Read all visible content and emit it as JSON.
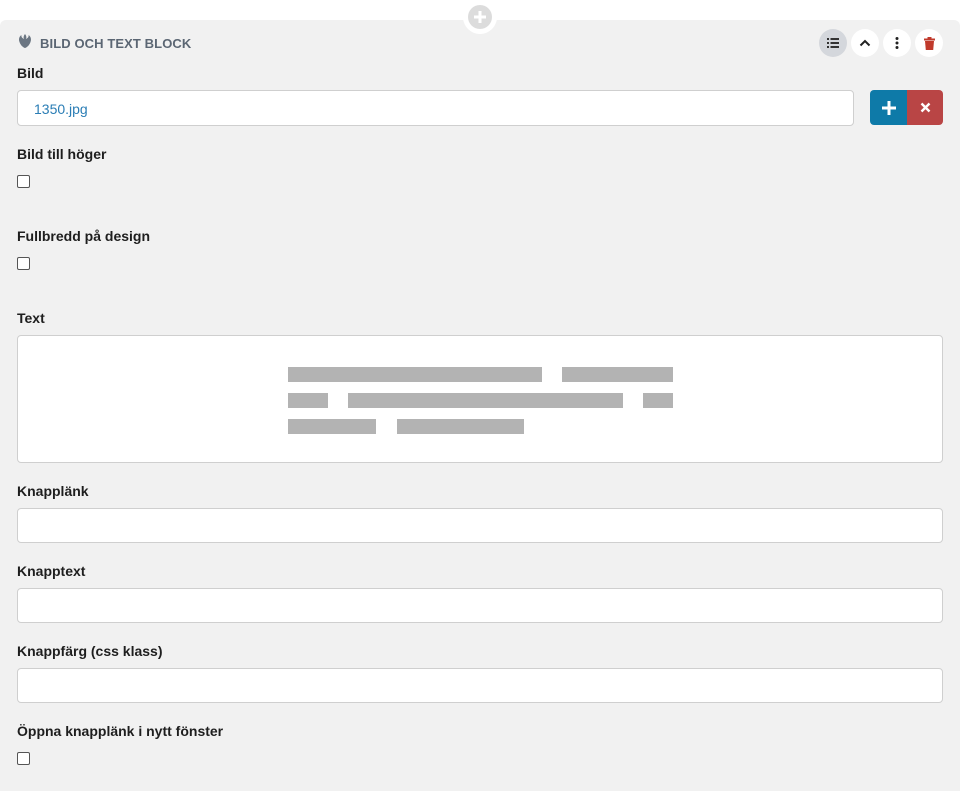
{
  "block": {
    "title": "BILD OCH TEXT BLOCK",
    "icon": "rebel-alliance-icon"
  },
  "toolbar": {
    "icons": [
      "list-icon",
      "chevron-up-icon",
      "vertical-dots-icon",
      "trash-icon"
    ]
  },
  "fields": {
    "image": {
      "label": "Bild",
      "value": "1350.jpg"
    },
    "image_right": {
      "label": "Bild till höger",
      "checked": false
    },
    "full_width": {
      "label": "Fullbredd på design",
      "checked": false
    },
    "text": {
      "label": "Text"
    },
    "button_link": {
      "label": "Knapplänk",
      "value": ""
    },
    "button_text": {
      "label": "Knapptext",
      "value": ""
    },
    "button_color": {
      "label": "Knappfärg (css klass)",
      "value": ""
    },
    "open_new_window": {
      "label": "Öppna knapplänk i nytt fönster",
      "checked": false
    }
  },
  "colors": {
    "add_button": "#0e7aa8",
    "remove_button": "#b94545",
    "trash": "#c0392b",
    "file_link": "#2a7db5"
  }
}
